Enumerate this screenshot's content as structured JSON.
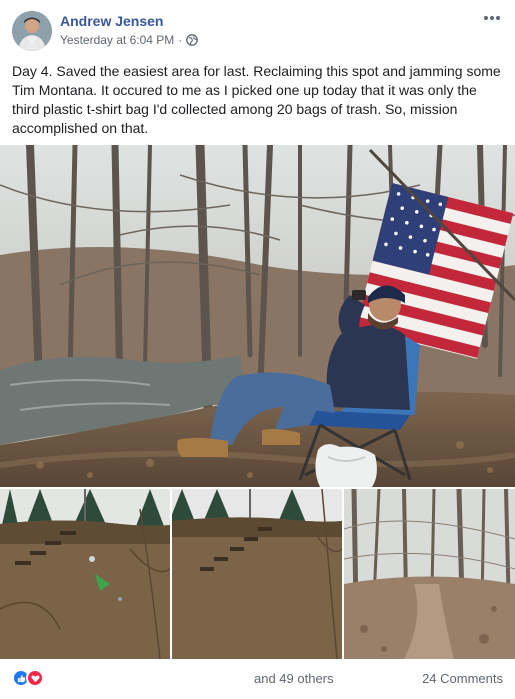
{
  "post": {
    "author": "Andrew Jensen",
    "timestamp": "Yesterday at 6:04 PM",
    "separator": "·",
    "privacy_icon": "globe-icon",
    "menu_icon": "more-options-icon",
    "text": "Day 4. Saved the easiest area for last. Reclaiming this spot and jamming some Tim Montana. It occured to me as I picked one up today that it was only the third plastic t-shirt bag I'd collected among 20 bags of trash. So, mission accomplished on that."
  },
  "photos": [
    {
      "description": "man-sitting-by-creek-with-flag",
      "kind": "main"
    },
    {
      "description": "cleared-hillside-steps-with-litter",
      "kind": "thumb"
    },
    {
      "description": "cleared-hillside-steps",
      "kind": "thumb"
    },
    {
      "description": "woods-path",
      "kind": "thumb"
    }
  ],
  "footer": {
    "reaction_icons": [
      "like-icon",
      "love-icon"
    ],
    "reactors_text": "and 49 others",
    "comments_text": "24 Comments"
  },
  "colors": {
    "author_link": "#385898",
    "meta_text": "#606770",
    "like_blue": "#2078f4",
    "love_red": "#f0284a"
  }
}
